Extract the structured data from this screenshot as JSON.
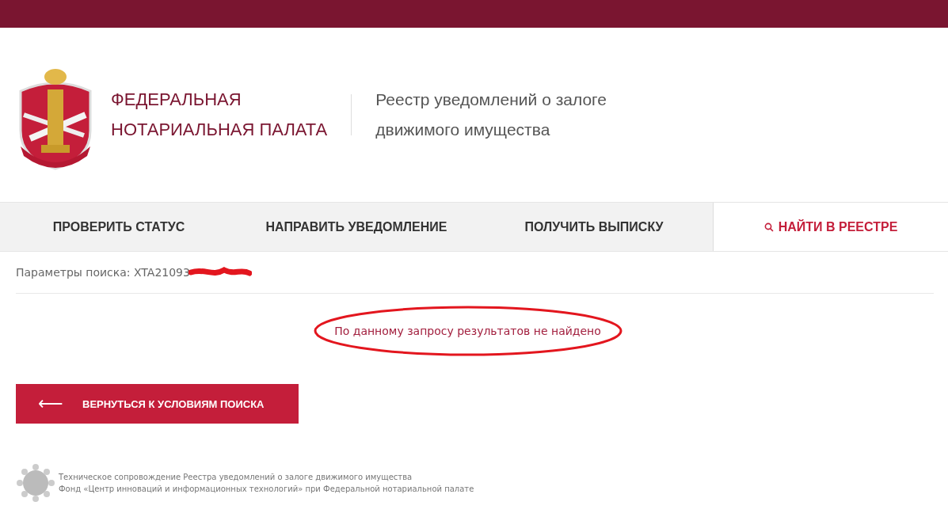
{
  "org": {
    "name_line1": "ФЕДЕРАЛЬНАЯ",
    "name_line2": "НОТАРИАЛЬНАЯ ПАЛАТА"
  },
  "registry": {
    "line1": "Реестр уведомлений о залоге",
    "line2": "движимого имущества"
  },
  "tabs": [
    {
      "label": "ПРОВЕРИТЬ СТАТУС",
      "selected": false,
      "icon": false
    },
    {
      "label": "НАПРАВИТЬ УВЕДОМЛЕНИЕ",
      "selected": false,
      "icon": false
    },
    {
      "label": "ПОЛУЧИТЬ ВЫПИСКУ",
      "selected": false,
      "icon": false
    },
    {
      "label": "НАЙТИ В РЕЕСТРЕ",
      "selected": true,
      "icon": true
    }
  ],
  "search_params": "Параметры поиска: XTA21093",
  "result_message": "По данному запросу результатов не найдено",
  "back_button": {
    "arrow": "⟵",
    "label": "ВЕРНУТЬСЯ К УСЛОВИЯМ ПОИСКА"
  },
  "footer": {
    "line1": "Техническое сопровождение Реестра уведомлений о залоге движимого имущества",
    "line2": "Фонд «Центр инноваций и информационных технологий» при Федеральной нотариальной палате"
  }
}
